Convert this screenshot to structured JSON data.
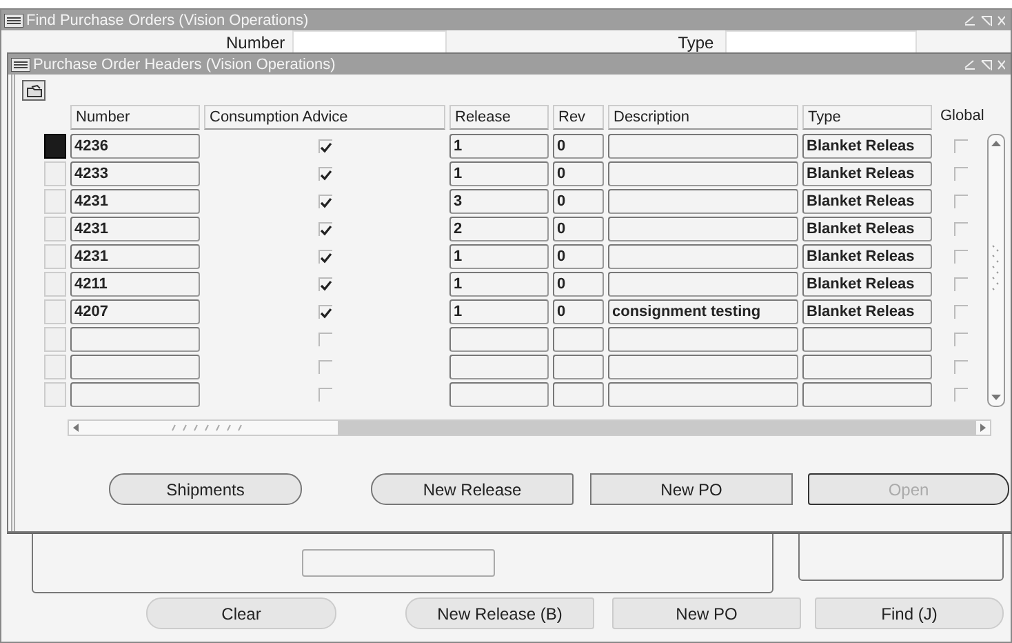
{
  "back_window": {
    "title": "Find Purchase Orders (Vision Operations)",
    "fields": [
      {
        "label": "Number"
      },
      {
        "label": "Type"
      }
    ],
    "buttons": [
      {
        "label": "Clear",
        "disabled": false,
        "default": false
      },
      {
        "label": "New Release (B)",
        "disabled": false,
        "default": false
      },
      {
        "label": "New PO",
        "disabled": false,
        "default": false
      },
      {
        "label": "Find (J)",
        "disabled": false,
        "default": false
      }
    ]
  },
  "front_window": {
    "title": "Purchase Order Headers (Vision Operations)",
    "table": {
      "columns": [
        "Number",
        "Consumption Advice",
        "Release",
        "Rev",
        "Description",
        "Type",
        "Global"
      ],
      "rows": [
        {
          "selected": true,
          "number": "4236",
          "consumption_advice": true,
          "release": "1",
          "rev": "0",
          "type": "Blanket Releas",
          "global": false
        },
        {
          "selected": false,
          "number": "4233",
          "consumption_advice": true,
          "release": "1",
          "rev": "0",
          "type": "Blanket Releas",
          "global": false
        },
        {
          "selected": false,
          "number": "4231",
          "consumption_advice": true,
          "release": "3",
          "rev": "0",
          "type": "Blanket Releas",
          "global": false
        },
        {
          "selected": false,
          "number": "4231",
          "consumption_advice": true,
          "release": "2",
          "rev": "0",
          "type": "Blanket Releas",
          "global": false
        },
        {
          "selected": false,
          "number": "4231",
          "consumption_advice": true,
          "release": "1",
          "rev": "0",
          "type": "Blanket Releas",
          "global": false
        },
        {
          "selected": false,
          "number": "4211",
          "consumption_advice": true,
          "release": "1",
          "rev": "0",
          "type": "Blanket Releas",
          "global": false
        },
        {
          "selected": false,
          "number": "4207",
          "consumption_advice": true,
          "release": "1",
          "rev": "0",
          "description": "consignment testing",
          "type": "Blanket Releas",
          "global": false
        },
        {
          "selected": false,
          "consumption_advice": false,
          "global": false
        },
        {
          "selected": false,
          "consumption_advice": false,
          "global": false
        },
        {
          "selected": false,
          "consumption_advice": false,
          "global": false
        }
      ]
    },
    "buttons": [
      {
        "label": "Shipments",
        "disabled": false,
        "default": false
      },
      {
        "label": "New Release",
        "disabled": false,
        "default": false
      },
      {
        "label": "New PO",
        "disabled": false,
        "default": false
      },
      {
        "label": "Open",
        "disabled": true,
        "default": true
      }
    ]
  }
}
